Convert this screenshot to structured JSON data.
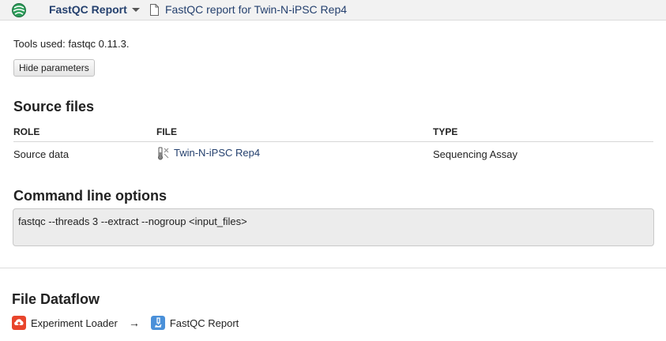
{
  "header": {
    "app_menu_label": "FastQC Report",
    "document_title": "FastQC report for Twin-N-iPSC Rep4"
  },
  "tools_used": "Tools used: fastqc 0.11.3.",
  "hide_params_label": "Hide parameters",
  "source_files": {
    "heading": "Source files",
    "columns": [
      "ROLE",
      "FILE",
      "TYPE"
    ],
    "rows": [
      {
        "role": "Source data",
        "file": "Twin-N-iPSC Rep4",
        "type": "Sequencing Assay"
      }
    ]
  },
  "command_line": {
    "heading": "Command line options",
    "value": "fastqc --threads 3 --extract --nogroup <input_files>"
  },
  "dataflow": {
    "heading": "File Dataflow",
    "from": "Experiment Loader",
    "arrow": "→",
    "to": "FastQC Report"
  },
  "icons": {
    "logo": "globe-logo-icon",
    "menu": "caret-down-icon",
    "document": "document-icon",
    "file": "test-tube-icon",
    "loader": "cloud-upload-icon",
    "report": "microscope-icon"
  },
  "colors": {
    "link": "#24406e",
    "loader_icon": "#e8452c",
    "report_icon": "#4a90d9"
  }
}
